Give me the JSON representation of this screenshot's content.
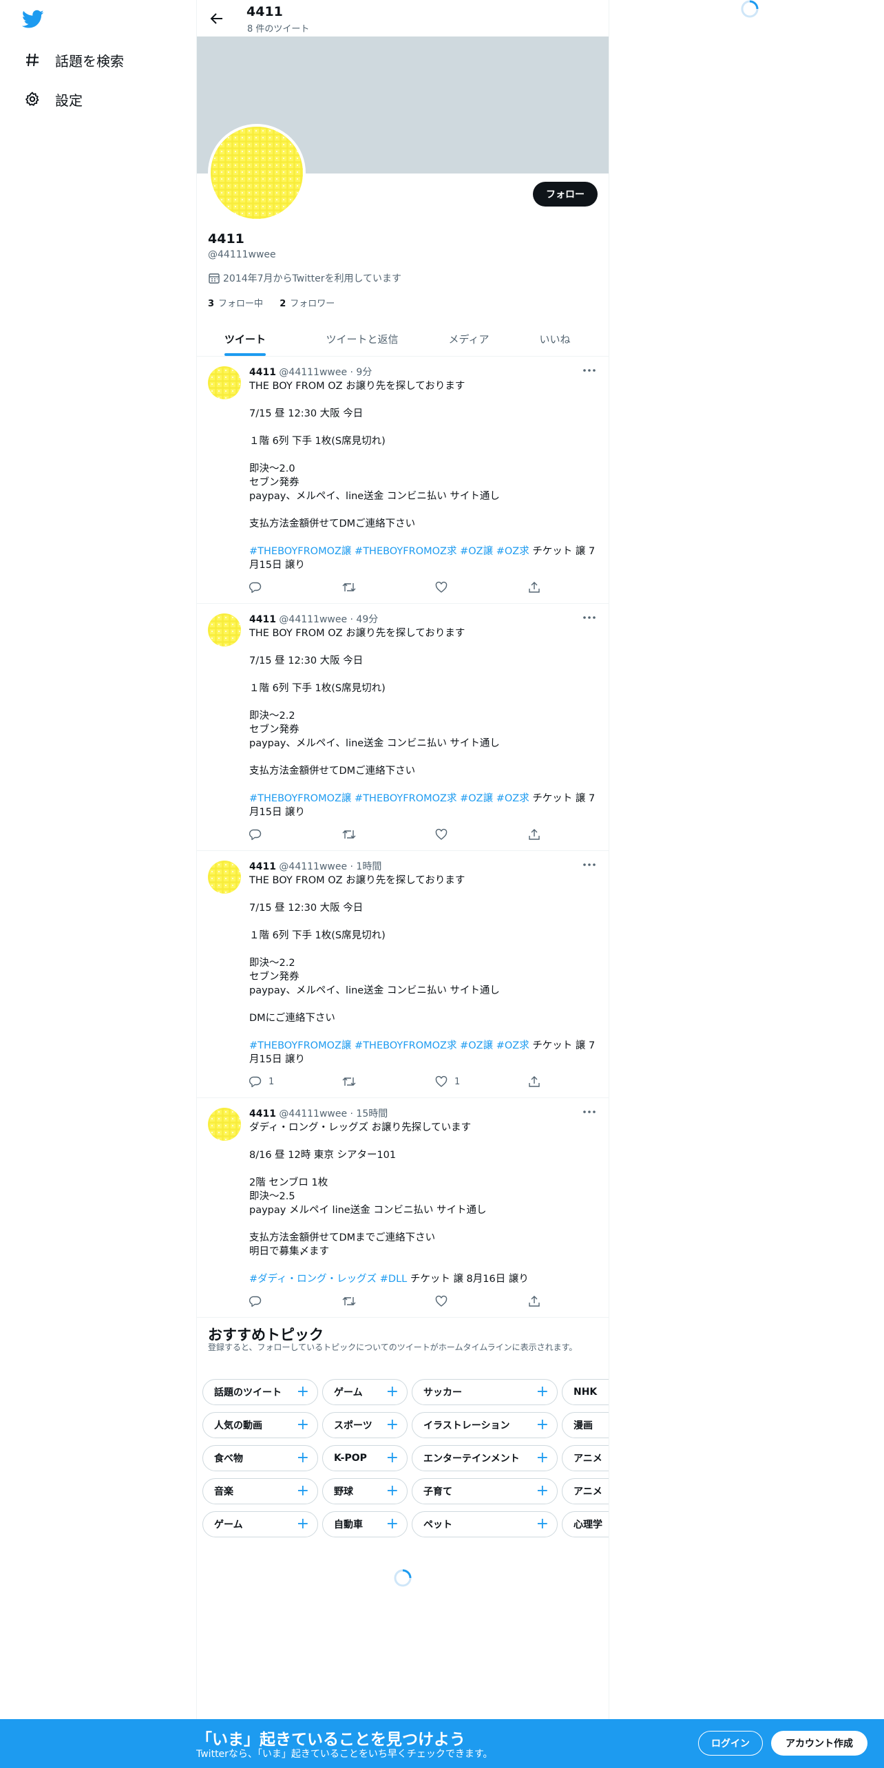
{
  "nav": {
    "explore_label": "話題を検索",
    "settings_label": "設定"
  },
  "header": {
    "name": "4411",
    "tweet_count": "8 件のツイート"
  },
  "profile": {
    "name": "4411",
    "handle": "@44111wwee",
    "joined": "2014年7月からTwitterを利用しています",
    "following_count": "3",
    "following_label": "フォロー中",
    "followers_count": "2",
    "followers_label": "フォロワー",
    "follow_button": "フォロー"
  },
  "tabs": [
    {
      "label": "ツイート"
    },
    {
      "label": "ツイートと返信"
    },
    {
      "label": "メディア"
    },
    {
      "label": "いいね"
    }
  ],
  "tweets": [
    {
      "name": "4411",
      "meta": "@44111wwee · 9分",
      "l1": "THE BOY FROM OZ お譲り先を探しております",
      "l2": "7/15 昼 12:30 大阪 今日",
      "l3": "１階 6列 下手 1枚(S席見切れ)",
      "l4": "即決～2.0",
      "l5": "セブン発券",
      "l6": "paypay、メルペイ、line送金 コンビニ払い サイト通し",
      "l7": "支払方法金額併せてDMご連絡下さい",
      "h1": "#THEBOYFROMOZ譲",
      "h2": "#THEBOYFROMOZ求",
      "h3": "#OZ譲",
      "h4": "#OZ求",
      "tail1": "チケット 譲 7",
      "tail2": "月15日 譲り",
      "reply_count": "",
      "like_count": ""
    },
    {
      "name": "4411",
      "meta": "@44111wwee · 49分",
      "l1": "THE BOY FROM OZ お譲り先を探しております",
      "l2": "7/15 昼 12:30 大阪 今日",
      "l3": "１階 6列 下手 1枚(S席見切れ)",
      "l4": "即決～2.2",
      "l5": "セブン発券",
      "l6": "paypay、メルペイ、line送金 コンビニ払い サイト通し",
      "l7": "支払方法金額併せてDMご連絡下さい",
      "h1": "#THEBOYFROMOZ譲",
      "h2": "#THEBOYFROMOZ求",
      "h3": "#OZ譲",
      "h4": "#OZ求",
      "tail1": "チケット 譲 7",
      "tail2": "月15日 譲り",
      "reply_count": "",
      "like_count": ""
    },
    {
      "name": "4411",
      "meta": "@44111wwee · 1時間",
      "l1": "THE BOY FROM OZ お譲り先を探しております",
      "l2": "7/15 昼 12:30 大阪 今日",
      "l3": "１階 6列 下手 1枚(S席見切れ)",
      "l4": "即決～2.2",
      "l5": "セブン発券",
      "l6": "paypay、メルペイ、line送金 コンビニ払い サイト通し",
      "l7": "DMにご連絡下さい",
      "h1": "#THEBOYFROMOZ譲",
      "h2": "#THEBOYFROMOZ求",
      "h3": "#OZ譲",
      "h4": "#OZ求",
      "tail1": "チケット 譲 7",
      "tail2": "月15日 譲り",
      "reply_count": "1",
      "like_count": "1"
    },
    {
      "name": "4411",
      "meta": "@44111wwee · 15時間",
      "l1": "ダディ・ロング・レッグズ お譲り先探しています",
      "l2": "8/16 昼 12時 東京 シアター101",
      "l3": "2階 センブロ 1枚",
      "l4": "即決～2.5",
      "l5": "paypay メルペイ line送金 コンビニ払い サイト通し",
      "l6": "支払方法金額併せてDMまでご連絡下さい",
      "l7": "明日で募集〆ます",
      "h1": "#ダディ・ロング・レッグズ",
      "h2": "#DLL",
      "tail1": "チケット 譲 8月16日 譲り",
      "reply_count": "",
      "like_count": ""
    }
  ],
  "topics": {
    "title": "おすすめトピック",
    "subtitle": "登録すると、フォローしているトピックについてのツイートがホームタイムラインに表示されます。",
    "chips": [
      "話題のツイート",
      "ゲーム",
      "サッカー",
      "NHK",
      "人気の動画",
      "スポーツ",
      "イラストレーション",
      "漫画",
      "食べ物",
      "K-POP",
      "エンターテインメント",
      "アニメ",
      "音楽",
      "野球",
      "子育て",
      "アニメ",
      "ゲーム",
      "自動車",
      "ペット",
      "心理学"
    ],
    "plus": "+"
  },
  "bottom_bar": {
    "title": "「いま」起きていることを見つけよう",
    "subtitle": "Twitterなら、「いま」起きていることをいち早くチェックできます。",
    "login": "ログイン",
    "signup": "アカウント作成"
  },
  "colors": {
    "accent": "#1d9bf0",
    "avatar_yellow": "#fef65b",
    "banner": "#cfd9de"
  }
}
